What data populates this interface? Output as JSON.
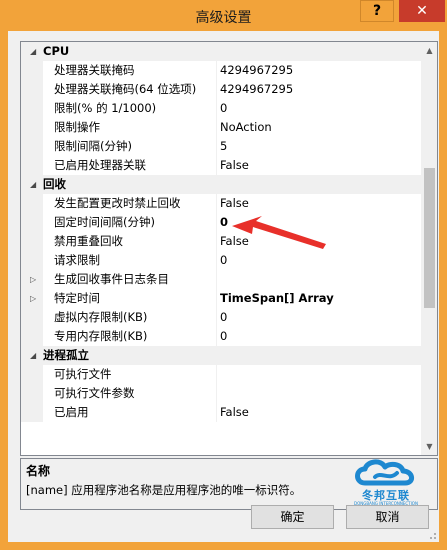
{
  "window": {
    "title": "高级设置",
    "help_label": "?",
    "close_label": "✕",
    "frame_color": "#f2a33a",
    "close_color": "#c73b2b"
  },
  "property_grid": {
    "rows": [
      {
        "type": "category",
        "name": "CPU",
        "toggle": "◢"
      },
      {
        "type": "prop",
        "name": "处理器关联掩码",
        "value": "4294967295"
      },
      {
        "type": "prop",
        "name": "处理器关联掩码(64 位选项)",
        "value": "4294967295"
      },
      {
        "type": "prop",
        "name": "限制(% 的 1/1000)",
        "value": "0"
      },
      {
        "type": "prop",
        "name": "限制操作",
        "value": "NoAction"
      },
      {
        "type": "prop",
        "name": "限制间隔(分钟)",
        "value": "5"
      },
      {
        "type": "prop",
        "name": "已启用处理器关联",
        "value": "False"
      },
      {
        "type": "category",
        "name": "回收",
        "toggle": "◢"
      },
      {
        "type": "prop",
        "name": "发生配置更改时禁止回收",
        "value": "False"
      },
      {
        "type": "prop",
        "name": "固定时间间隔(分钟)",
        "value": "0",
        "bold": true
      },
      {
        "type": "prop",
        "name": "禁用重叠回收",
        "value": "False"
      },
      {
        "type": "prop",
        "name": "请求限制",
        "value": "0"
      },
      {
        "type": "prop",
        "name": "生成回收事件日志条目",
        "value": "",
        "expand": "▷"
      },
      {
        "type": "prop",
        "name": "特定时间",
        "value": "TimeSpan[] Array",
        "bold": true,
        "expand": "▷"
      },
      {
        "type": "prop",
        "name": "虚拟内存限制(KB)",
        "value": "0"
      },
      {
        "type": "prop",
        "name": "专用内存限制(KB)",
        "value": "0"
      },
      {
        "type": "category",
        "name": "进程孤立",
        "toggle": "◢"
      },
      {
        "type": "prop",
        "name": "可执行文件",
        "value": ""
      },
      {
        "type": "prop",
        "name": "可执行文件参数",
        "value": ""
      },
      {
        "type": "prop",
        "name": "已启用",
        "value": "False"
      }
    ]
  },
  "description": {
    "title": "名称",
    "text": "[name] 应用程序池名称是应用程序池的唯一标识符。"
  },
  "watermark": {
    "text": "冬邦互联",
    "subtext": "DONGBANG INTERCONNECTION"
  },
  "buttons": {
    "ok": "确定",
    "cancel": "取消"
  },
  "annotation_color": "#e8302a"
}
